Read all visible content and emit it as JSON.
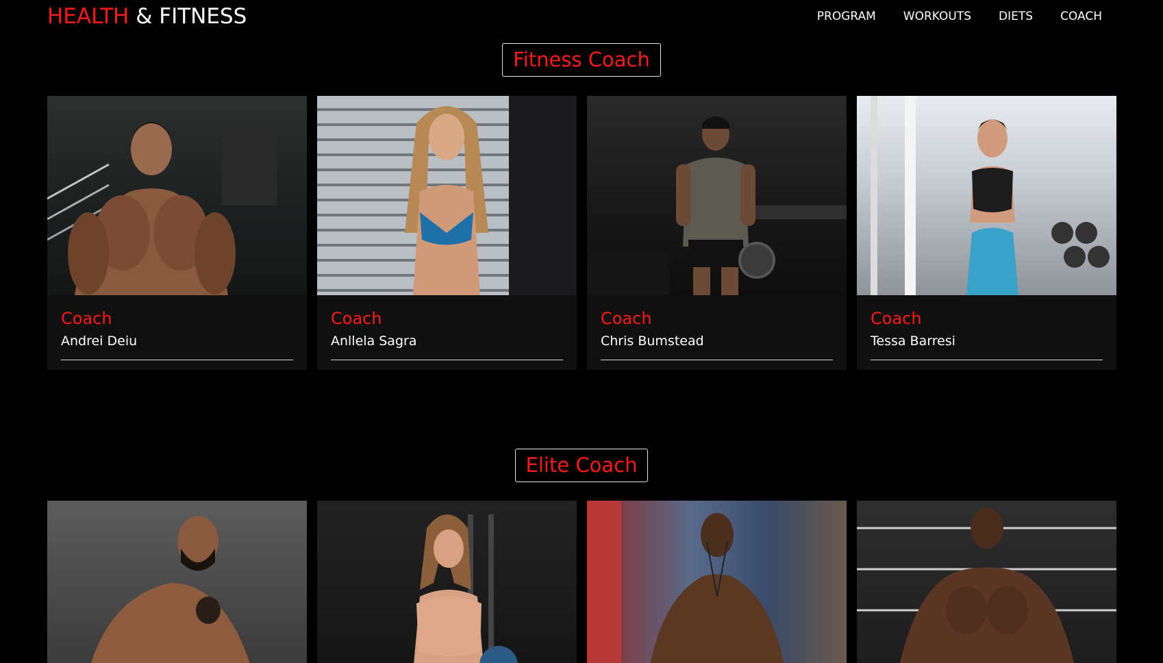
{
  "header": {
    "logo_accent": "HEALTH",
    "logo_rest": " & FITNESS",
    "nav": [
      "PROGRAM",
      "WORKOUTS",
      "DIETS",
      "COACH"
    ]
  },
  "sections": [
    {
      "title": "Fitness Coach",
      "cards": [
        {
          "role": "Coach",
          "name": "Andrei Deiu"
        },
        {
          "role": "Coach",
          "name": "Anllela Sagra"
        },
        {
          "role": "Coach",
          "name": "Chris Bumstead"
        },
        {
          "role": "Coach",
          "name": "Tessa Barresi"
        }
      ]
    },
    {
      "title": "Elite Coach",
      "cards": [
        {},
        {},
        {},
        {}
      ]
    }
  ],
  "colors": {
    "accent": "#ff1a1a",
    "background": "#000000",
    "card": "#101010"
  }
}
